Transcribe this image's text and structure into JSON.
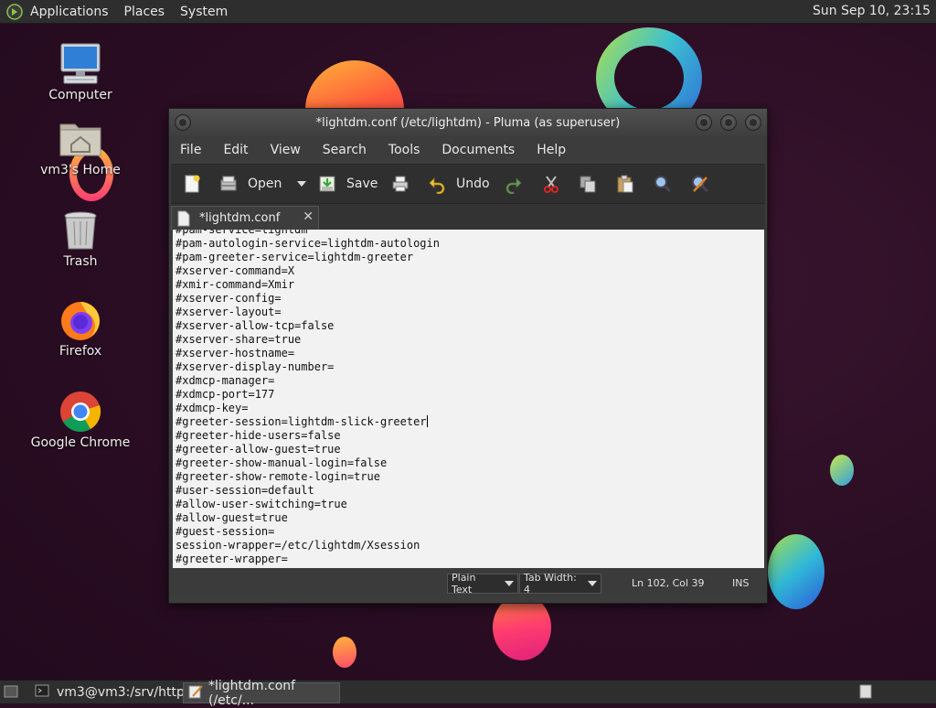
{
  "top_panel": {
    "menus": [
      "Applications",
      "Places",
      "System"
    ],
    "clock": "Sun Sep 10, 23:15"
  },
  "desktop_icons": [
    {
      "label": "Computer"
    },
    {
      "label": "vm3's Home"
    },
    {
      "label": "Trash"
    },
    {
      "label": "Firefox"
    },
    {
      "label": "Google Chrome"
    }
  ],
  "window": {
    "title": "*lightdm.conf (/etc/lightdm) - Pluma (as superuser)",
    "menu": [
      "File",
      "Edit",
      "View",
      "Search",
      "Tools",
      "Documents",
      "Help"
    ],
    "toolbar": {
      "open_label": "Open",
      "save_label": "Save",
      "undo_label": "Undo"
    },
    "tab_label": "*lightdm.conf",
    "tab_close": "✕",
    "editor_lines": [
      "#pam-service=lightdm",
      "#pam-autologin-service=lightdm-autologin",
      "#pam-greeter-service=lightdm-greeter",
      "#xserver-command=X",
      "#xmir-command=Xmir",
      "#xserver-config=",
      "#xserver-layout=",
      "#xserver-allow-tcp=false",
      "#xserver-share=true",
      "#xserver-hostname=",
      "#xserver-display-number=",
      "#xdmcp-manager=",
      "#xdmcp-port=177",
      "#xdmcp-key=",
      "#greeter-session=lightdm-slick-greeter",
      "#greeter-hide-users=false",
      "#greeter-allow-guest=true",
      "#greeter-show-manual-login=false",
      "#greeter-show-remote-login=true",
      "#user-session=default",
      "#allow-user-switching=true",
      "#allow-guest=true",
      "#guest-session=",
      "session-wrapper=/etc/lightdm/Xsession",
      "#greeter-wrapper="
    ],
    "status": {
      "language": "Plain Text",
      "tab_width": "Tab Width:  4",
      "position": "Ln 102, Col 39",
      "mode": "INS"
    }
  },
  "bottom_panel": {
    "tasks": [
      "vm3@vm3:/srv/http",
      "*lightdm.conf (/etc/..."
    ]
  },
  "colors": {
    "panel": "#2e2e2e",
    "editor_bg": "#f2f2f2",
    "desktop_bg": "#2a0d23"
  }
}
